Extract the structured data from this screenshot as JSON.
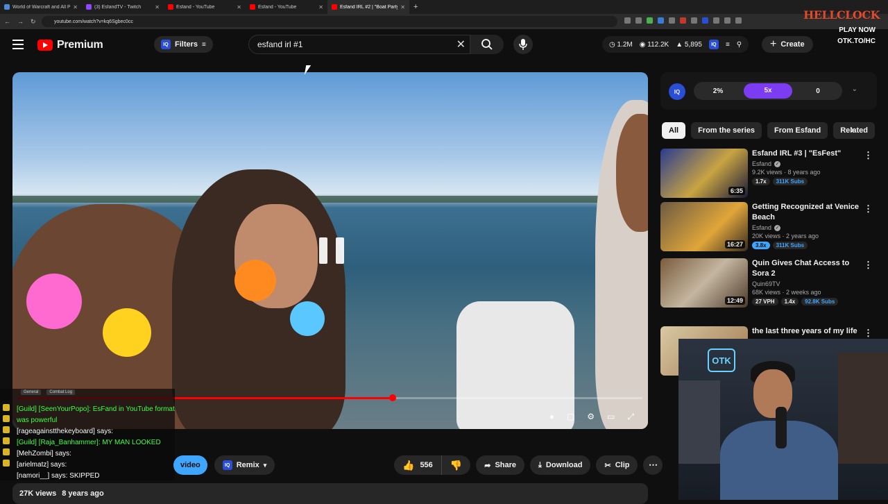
{
  "browser": {
    "tabs": [
      {
        "title": "World of Warcraft and All PC G",
        "color": "#4a8bd6"
      },
      {
        "title": "(3) EsfandTV - Twitch",
        "color": "#9146ff"
      },
      {
        "title": "Esfand - YouTube",
        "color": "#ff0000"
      },
      {
        "title": "Esfand - YouTube",
        "color": "#ff0000"
      },
      {
        "title": "Esfand IRL #2 | \"Boat Party\"",
        "color": "#ff0000"
      }
    ],
    "url": "youtube.com/watch?v=kq6Sgbec0cc"
  },
  "header": {
    "brand": "Premium",
    "filters_label": "Filters",
    "search_value": "esfand irl #1",
    "stats": [
      "1.2M",
      "112.2K",
      "5,895"
    ],
    "create_label": "Create"
  },
  "player": {
    "progress_fraction": 0.6
  },
  "chat": {
    "tabs": [
      "General",
      "Combat Log"
    ],
    "lines": [
      {
        "who": "[Guild] [SeenYourPopo]:",
        "msg": "EsFand in YouTube format was powerful",
        "cls": "g"
      },
      {
        "who": "[rageagainstthekeyboard] says:",
        "msg": "",
        "cls": "w"
      },
      {
        "who": "[Guild] [Raja_Banhammer]:",
        "msg": "MY MAN LOOKED",
        "cls": "g"
      },
      {
        "who": "[MehZombi] says:",
        "msg": "",
        "cls": "w"
      },
      {
        "who": "[arielmatz] says:",
        "msg": "",
        "cls": "w"
      },
      {
        "who": "[namori__] says:",
        "msg": "SKIPPED",
        "cls": "w"
      }
    ]
  },
  "actions": {
    "video_label": "video",
    "remix_label": "Remix",
    "like_count": "556",
    "share_label": "Share",
    "download_label": "Download",
    "clip_label": "Clip"
  },
  "meta": {
    "views": "27K views",
    "age": "8 years ago"
  },
  "iq": {
    "logo": "IQ",
    "segments": [
      "2%",
      "5x",
      "0"
    ]
  },
  "chips": [
    "All",
    "From the series",
    "From Esfand",
    "Related"
  ],
  "recs": [
    {
      "title": "Esfand IRL #3 | \"EsFest\"",
      "channel": "Esfand",
      "verified": true,
      "views": "9.2K views · 8 years ago",
      "duration": "6:35",
      "badges": [
        {
          "t": "1.7x",
          "c": ""
        },
        {
          "t": "311K Subs",
          "c": "bl"
        }
      ],
      "thumb": "linear-gradient(135deg,#2a3b8f,#c9a441 55%,#1a1a3a)"
    },
    {
      "title": "Getting Recognized at Venice Beach",
      "channel": "Esfand",
      "verified": true,
      "views": "20K views · 2 years ago",
      "duration": "16:27",
      "badges": [
        {
          "t": "3.8x",
          "c": "b"
        },
        {
          "t": "311K Subs",
          "c": "bl"
        }
      ],
      "thumb": "linear-gradient(135deg,#6b5a44,#e0a63a 60%,#3a2c22)"
    },
    {
      "title": "Quin Gives Chat Access to Sora 2",
      "channel": "Quin69TV",
      "verified": false,
      "views": "68K views · 2 weeks ago",
      "duration": "12:49",
      "badges": [
        {
          "t": "27 VPH",
          "c": ""
        },
        {
          "t": "1.4x",
          "c": ""
        },
        {
          "t": "92.8K Subs",
          "c": "bl"
        }
      ],
      "thumb": "linear-gradient(135deg,#7a5c3c,#c4b6a0 50%,#4d3a2a)"
    },
    {
      "title": "the last three years of my life",
      "channel": "",
      "verified": false,
      "views": "",
      "duration": "",
      "badges": [],
      "thumb": "linear-gradient(135deg,#d9c9a4,#a07850)"
    }
  ],
  "overlay": {
    "hellclock": "HELLCLOCK",
    "playnow": "PLAY NOW",
    "link": "OTK.TO/HC",
    "otk": "OTK"
  }
}
